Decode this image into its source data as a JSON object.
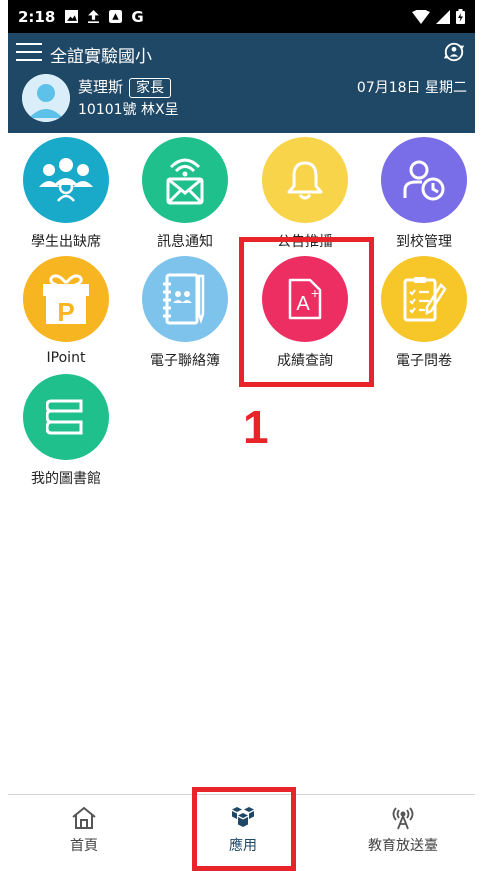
{
  "status_bar": {
    "time": "2:18",
    "g_letter": "G"
  },
  "header": {
    "school_name": "全誼實驗國小",
    "user_name": "莫理斯",
    "role": "家長",
    "student": "10101號 林X呈",
    "date": "07月18日 星期二"
  },
  "apps": [
    {
      "label": "學生出缺席",
      "icon": "students-icon",
      "color": "#1aaac9"
    },
    {
      "label": "訊息通知",
      "icon": "message-icon",
      "color": "#20c08d"
    },
    {
      "label": "公告推播",
      "icon": "bell-icon",
      "color": "#f7d44a"
    },
    {
      "label": "到校管理",
      "icon": "user-clock-icon",
      "color": "#7a6ee8"
    },
    {
      "label": "IPoint",
      "icon": "gift-icon",
      "color": "#f7b521"
    },
    {
      "label": "電子聯絡簿",
      "icon": "contact-book-icon",
      "color": "#7ec3ec"
    },
    {
      "label": "成績查詢",
      "icon": "grade-icon",
      "color": "#ec2e62"
    },
    {
      "label": "電子問卷",
      "icon": "survey-icon",
      "color": "#f7c629"
    },
    {
      "label": "我的圖書館",
      "icon": "library-icon",
      "color": "#20c08d"
    }
  ],
  "annotation": {
    "step": "1"
  },
  "bottom_nav": [
    {
      "label": "首頁",
      "icon": "home-icon"
    },
    {
      "label": "應用",
      "icon": "apps-icon"
    },
    {
      "label": "教育放送臺",
      "icon": "broadcast-icon"
    }
  ],
  "colors": {
    "header": "#1f4766",
    "highlight": "#e8232a"
  }
}
